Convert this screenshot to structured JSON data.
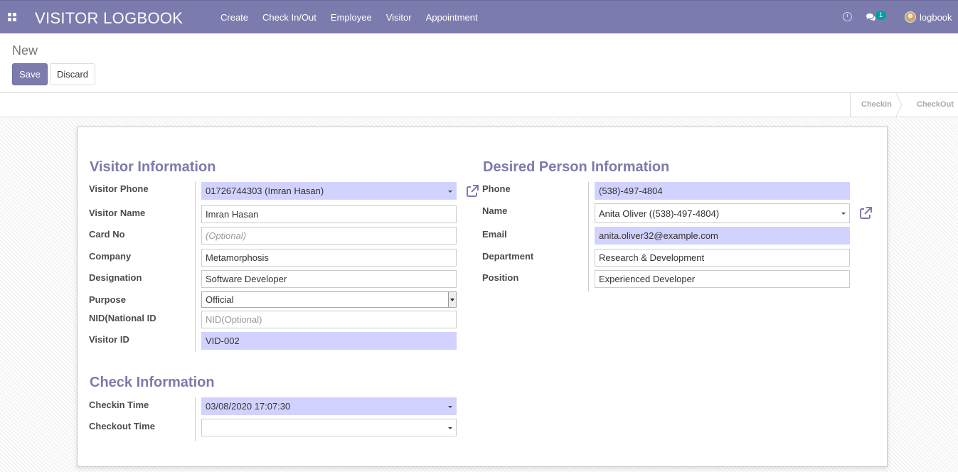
{
  "app": {
    "title": "VISITOR LOGBOOK",
    "user": "logbook",
    "chat_count": "1"
  },
  "menu": [
    "Create",
    "Check In/Out",
    "Employee",
    "Visitor",
    "Appointment"
  ],
  "breadcrumb": "New",
  "buttons": {
    "save": "Save",
    "discard": "Discard"
  },
  "status": [
    "CheckIn",
    "CheckOut"
  ],
  "visitor": {
    "title": "Visitor Information",
    "labels": [
      "Visitor Phone",
      "Visitor Name",
      "Card No",
      "Company",
      "Designation",
      "Purpose",
      "NID(National ID",
      "Visitor ID"
    ],
    "phone": "01726744303 (Imran Hasan)",
    "name": "Imran Hasan",
    "card_no_placeholder": "(Optional)",
    "company": "Metamorphosis",
    "designation": "Software Developer",
    "purpose": "Official",
    "nid_placeholder": "NID(Optional)",
    "visitor_id": "VID-002"
  },
  "desired": {
    "title": "Desired Person Information",
    "labels": [
      "Phone",
      "Name",
      "Email",
      "Department",
      "Position"
    ],
    "phone": "(538)-497-4804",
    "name": "Anita Oliver ((538)-497-4804)",
    "email": "anita.oliver32@example.com",
    "department": "Research & Development",
    "position": "Experienced Developer"
  },
  "check": {
    "title": "Check Information",
    "labels": [
      "Checkin Time",
      "Checkout Time"
    ],
    "checkin": "03/08/2020 17:07:30",
    "checkout": ""
  },
  "colors": {
    "brand": "#7c7bad",
    "required_field": "#d2d2ff",
    "badge": "#00a09d"
  }
}
